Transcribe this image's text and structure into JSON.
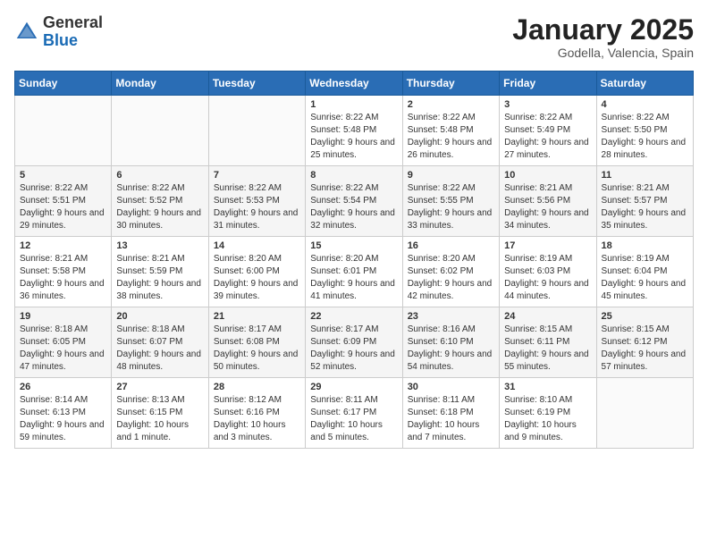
{
  "header": {
    "logo_general": "General",
    "logo_blue": "Blue",
    "month_title": "January 2025",
    "location": "Godella, Valencia, Spain"
  },
  "days_of_week": [
    "Sunday",
    "Monday",
    "Tuesday",
    "Wednesday",
    "Thursday",
    "Friday",
    "Saturday"
  ],
  "weeks": [
    [
      {
        "day": "",
        "info": ""
      },
      {
        "day": "",
        "info": ""
      },
      {
        "day": "",
        "info": ""
      },
      {
        "day": "1",
        "info": "Sunrise: 8:22 AM\nSunset: 5:48 PM\nDaylight: 9 hours and 25 minutes."
      },
      {
        "day": "2",
        "info": "Sunrise: 8:22 AM\nSunset: 5:48 PM\nDaylight: 9 hours and 26 minutes."
      },
      {
        "day": "3",
        "info": "Sunrise: 8:22 AM\nSunset: 5:49 PM\nDaylight: 9 hours and 27 minutes."
      },
      {
        "day": "4",
        "info": "Sunrise: 8:22 AM\nSunset: 5:50 PM\nDaylight: 9 hours and 28 minutes."
      }
    ],
    [
      {
        "day": "5",
        "info": "Sunrise: 8:22 AM\nSunset: 5:51 PM\nDaylight: 9 hours and 29 minutes."
      },
      {
        "day": "6",
        "info": "Sunrise: 8:22 AM\nSunset: 5:52 PM\nDaylight: 9 hours and 30 minutes."
      },
      {
        "day": "7",
        "info": "Sunrise: 8:22 AM\nSunset: 5:53 PM\nDaylight: 9 hours and 31 minutes."
      },
      {
        "day": "8",
        "info": "Sunrise: 8:22 AM\nSunset: 5:54 PM\nDaylight: 9 hours and 32 minutes."
      },
      {
        "day": "9",
        "info": "Sunrise: 8:22 AM\nSunset: 5:55 PM\nDaylight: 9 hours and 33 minutes."
      },
      {
        "day": "10",
        "info": "Sunrise: 8:21 AM\nSunset: 5:56 PM\nDaylight: 9 hours and 34 minutes."
      },
      {
        "day": "11",
        "info": "Sunrise: 8:21 AM\nSunset: 5:57 PM\nDaylight: 9 hours and 35 minutes."
      }
    ],
    [
      {
        "day": "12",
        "info": "Sunrise: 8:21 AM\nSunset: 5:58 PM\nDaylight: 9 hours and 36 minutes."
      },
      {
        "day": "13",
        "info": "Sunrise: 8:21 AM\nSunset: 5:59 PM\nDaylight: 9 hours and 38 minutes."
      },
      {
        "day": "14",
        "info": "Sunrise: 8:20 AM\nSunset: 6:00 PM\nDaylight: 9 hours and 39 minutes."
      },
      {
        "day": "15",
        "info": "Sunrise: 8:20 AM\nSunset: 6:01 PM\nDaylight: 9 hours and 41 minutes."
      },
      {
        "day": "16",
        "info": "Sunrise: 8:20 AM\nSunset: 6:02 PM\nDaylight: 9 hours and 42 minutes."
      },
      {
        "day": "17",
        "info": "Sunrise: 8:19 AM\nSunset: 6:03 PM\nDaylight: 9 hours and 44 minutes."
      },
      {
        "day": "18",
        "info": "Sunrise: 8:19 AM\nSunset: 6:04 PM\nDaylight: 9 hours and 45 minutes."
      }
    ],
    [
      {
        "day": "19",
        "info": "Sunrise: 8:18 AM\nSunset: 6:05 PM\nDaylight: 9 hours and 47 minutes."
      },
      {
        "day": "20",
        "info": "Sunrise: 8:18 AM\nSunset: 6:07 PM\nDaylight: 9 hours and 48 minutes."
      },
      {
        "day": "21",
        "info": "Sunrise: 8:17 AM\nSunset: 6:08 PM\nDaylight: 9 hours and 50 minutes."
      },
      {
        "day": "22",
        "info": "Sunrise: 8:17 AM\nSunset: 6:09 PM\nDaylight: 9 hours and 52 minutes."
      },
      {
        "day": "23",
        "info": "Sunrise: 8:16 AM\nSunset: 6:10 PM\nDaylight: 9 hours and 54 minutes."
      },
      {
        "day": "24",
        "info": "Sunrise: 8:15 AM\nSunset: 6:11 PM\nDaylight: 9 hours and 55 minutes."
      },
      {
        "day": "25",
        "info": "Sunrise: 8:15 AM\nSunset: 6:12 PM\nDaylight: 9 hours and 57 minutes."
      }
    ],
    [
      {
        "day": "26",
        "info": "Sunrise: 8:14 AM\nSunset: 6:13 PM\nDaylight: 9 hours and 59 minutes."
      },
      {
        "day": "27",
        "info": "Sunrise: 8:13 AM\nSunset: 6:15 PM\nDaylight: 10 hours and 1 minute."
      },
      {
        "day": "28",
        "info": "Sunrise: 8:12 AM\nSunset: 6:16 PM\nDaylight: 10 hours and 3 minutes."
      },
      {
        "day": "29",
        "info": "Sunrise: 8:11 AM\nSunset: 6:17 PM\nDaylight: 10 hours and 5 minutes."
      },
      {
        "day": "30",
        "info": "Sunrise: 8:11 AM\nSunset: 6:18 PM\nDaylight: 10 hours and 7 minutes."
      },
      {
        "day": "31",
        "info": "Sunrise: 8:10 AM\nSunset: 6:19 PM\nDaylight: 10 hours and 9 minutes."
      },
      {
        "day": "",
        "info": ""
      }
    ]
  ]
}
